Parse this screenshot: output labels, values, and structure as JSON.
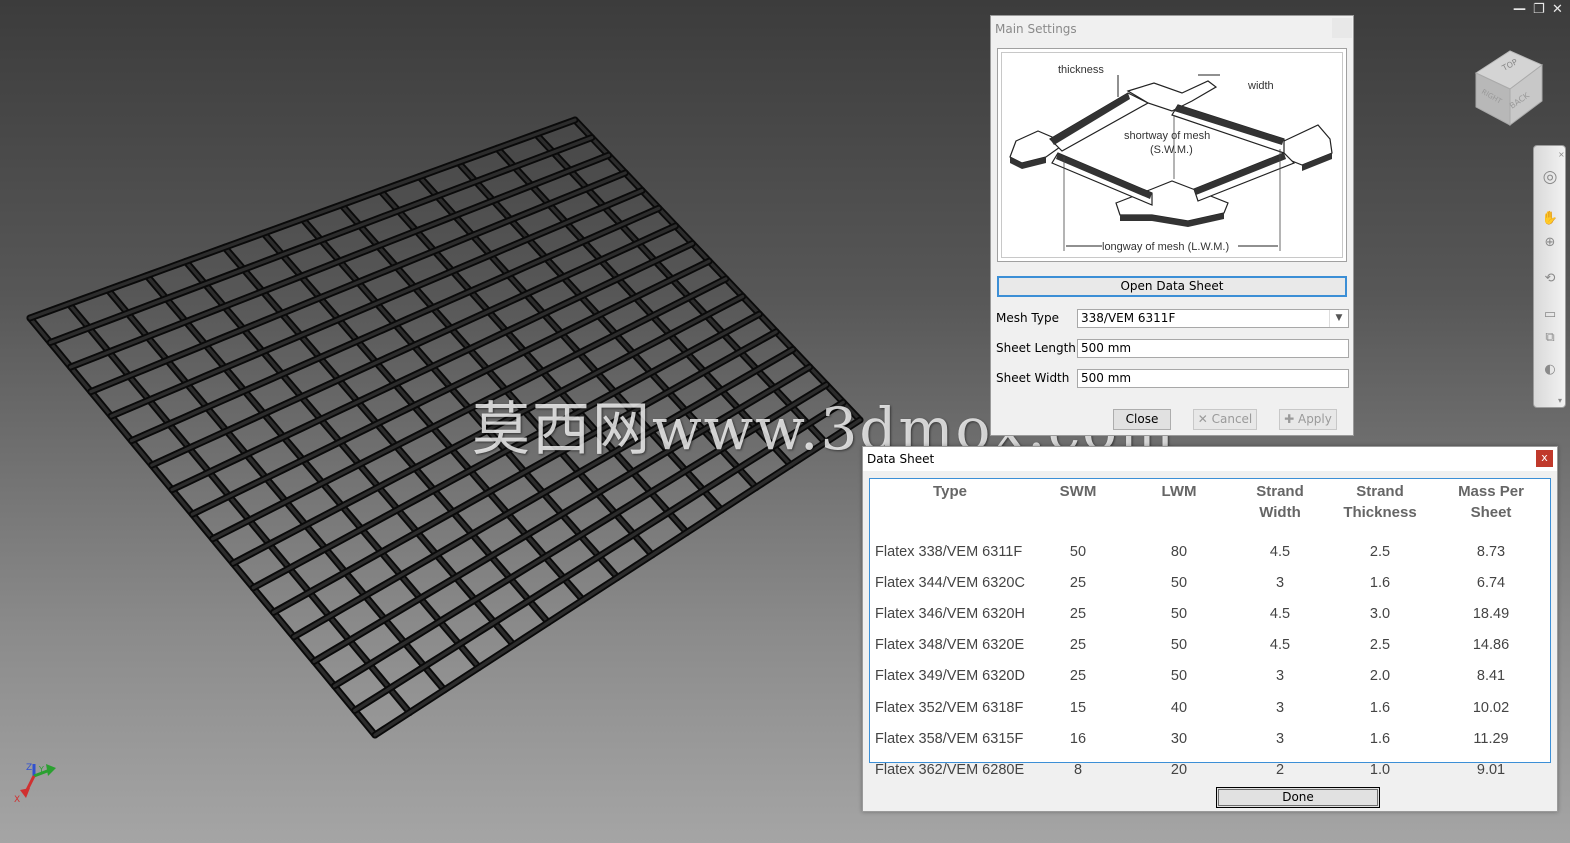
{
  "window_controls": {
    "minimize": "—",
    "restore": "❐",
    "close": "✕"
  },
  "viewcube": {
    "top_label": "TOP",
    "back_label": "BACK",
    "right_label": "RIGHT"
  },
  "axis_triad": {
    "x_label": "X",
    "y_label": "Y",
    "z_label": "Z"
  },
  "watermark": "莫西网www.3dmox.com",
  "main_settings": {
    "title": "Main Settings",
    "diagram": {
      "thickness_label": "thickness",
      "width_label": "width",
      "swm_label_line1": "shortway of mesh",
      "swm_label_line2": "(S.W.M.)",
      "lwm_label": "longway of mesh (L.W.M.)"
    },
    "open_data_sheet_label": "Open Data Sheet",
    "mesh_type_label": "Mesh Type",
    "mesh_type_value": "338/VEM 6311F",
    "sheet_length_label": "Sheet Length",
    "sheet_length_value": "500 mm",
    "sheet_width_label": "Sheet Width",
    "sheet_width_value": "500 mm",
    "close_label": "Close",
    "cancel_label": "Cancel",
    "apply_label": "Apply"
  },
  "data_sheet": {
    "title": "Data Sheet",
    "close_label": "x",
    "headers": [
      {
        "line1": "Type",
        "line2": ""
      },
      {
        "line1": "SWM",
        "line2": ""
      },
      {
        "line1": "LWM",
        "line2": ""
      },
      {
        "line1": "Strand",
        "line2": "Width"
      },
      {
        "line1": "Strand",
        "line2": "Thickness"
      },
      {
        "line1": "Mass Per",
        "line2": "Sheet"
      }
    ],
    "rows": [
      [
        "Flatex 338/VEM 6311F",
        "50",
        "80",
        "4.5",
        "2.5",
        "8.73"
      ],
      [
        "Flatex 344/VEM 6320C",
        "25",
        "50",
        "3",
        "1.6",
        "6.74"
      ],
      [
        "Flatex 346/VEM 6320H",
        "25",
        "50",
        "4.5",
        "3.0",
        "18.49"
      ],
      [
        "Flatex 348/VEM 6320E",
        "25",
        "50",
        "4.5",
        "2.5",
        "14.86"
      ],
      [
        "Flatex 349/VEM 6320D",
        "25",
        "50",
        "3",
        "2.0",
        "8.41"
      ],
      [
        "Flatex 352/VEM 6318F",
        "15",
        "40",
        "3",
        "1.6",
        "10.02"
      ],
      [
        "Flatex 358/VEM 6315F",
        "16",
        "30",
        "3",
        "1.6",
        "11.29"
      ],
      [
        "Flatex 362/VEM 6280E",
        "8",
        "20",
        "2",
        "1.0",
        "9.01"
      ]
    ],
    "done_label": "Done"
  },
  "nav_bar_icons": [
    "steering-wheel",
    "pan",
    "zoom",
    "orbit",
    "look-at",
    "view-face",
    "appearance"
  ]
}
